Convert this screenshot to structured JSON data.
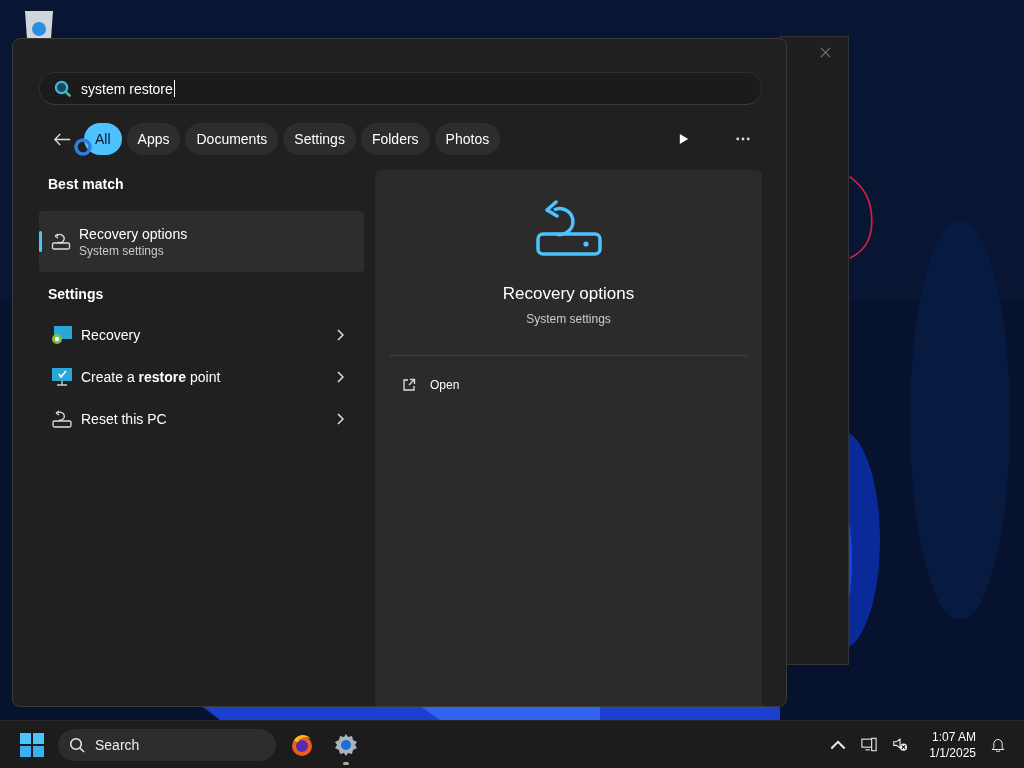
{
  "search": {
    "value": "system restore"
  },
  "filters": [
    {
      "label": "All",
      "selected": true
    },
    {
      "label": "Apps",
      "selected": false
    },
    {
      "label": "Documents",
      "selected": false
    },
    {
      "label": "Settings",
      "selected": false
    },
    {
      "label": "Folders",
      "selected": false
    },
    {
      "label": "Photos",
      "selected": false
    }
  ],
  "best_match": {
    "heading": "Best match",
    "items": [
      {
        "title": "Recovery options",
        "subtitle": "System settings",
        "selected": true
      }
    ]
  },
  "settings": {
    "heading": "Settings",
    "items": [
      {
        "label": "Recovery",
        "kind": "recovery"
      },
      {
        "label": "Create a **restore** point",
        "kind": "restore"
      },
      {
        "label": "Reset this PC",
        "kind": "reset"
      }
    ]
  },
  "preview": {
    "title": "Recovery options",
    "subtitle": "System settings",
    "actions": [
      {
        "label": "Open"
      }
    ]
  },
  "taskbar": {
    "search_placeholder": "Search",
    "time": "1:07 AM",
    "date": "1/1/2025"
  }
}
